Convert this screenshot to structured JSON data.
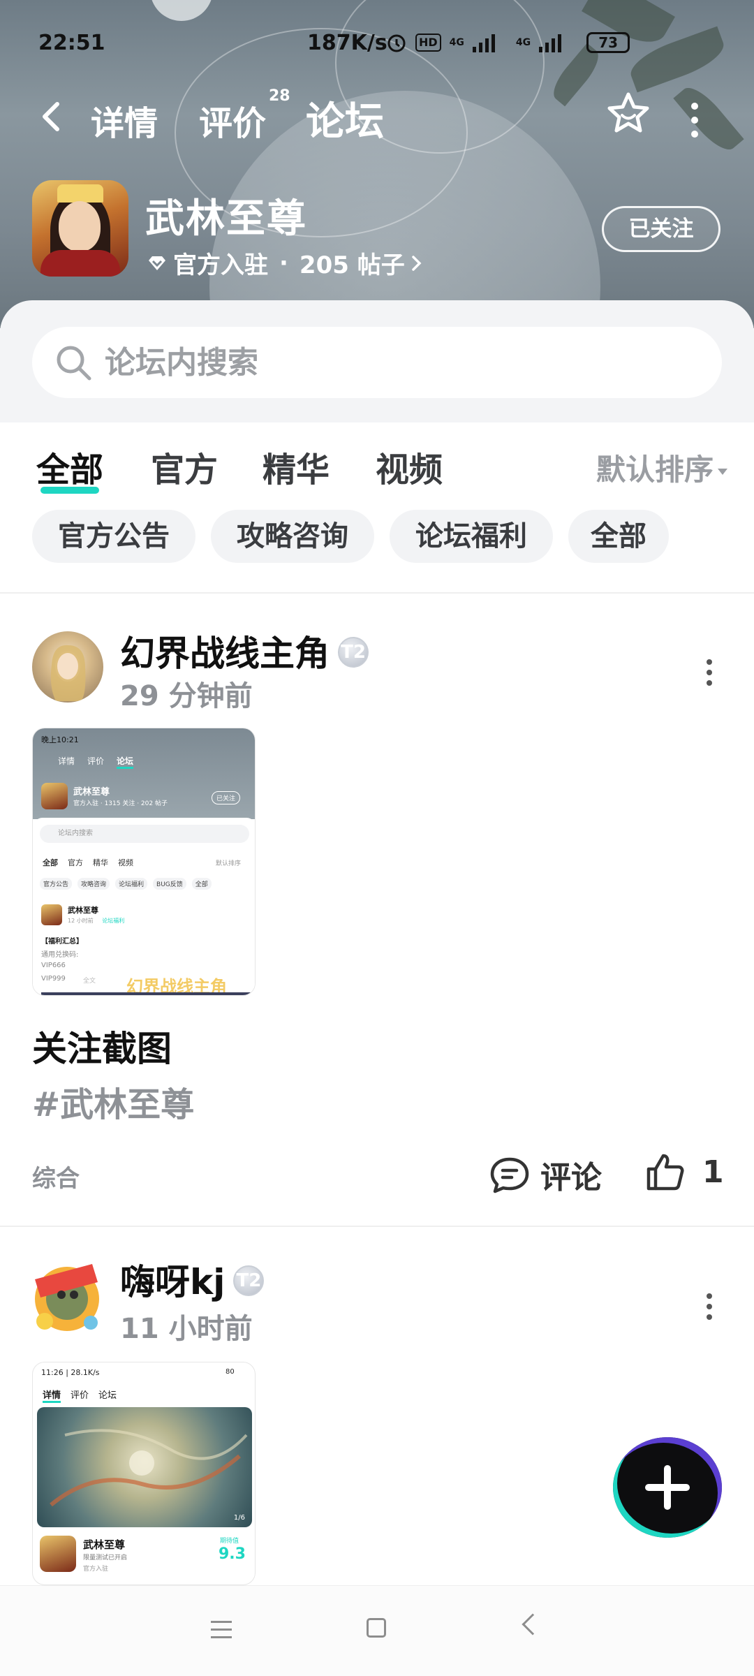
{
  "status_bar": {
    "time": "22:51",
    "net_speed": "187K/s",
    "hd": "HD",
    "net1": "4G",
    "net2": "4G",
    "battery": "73"
  },
  "nav": {
    "tabs": [
      {
        "label": "详情"
      },
      {
        "label": "评价",
        "badge": "28"
      },
      {
        "label": "论坛"
      }
    ],
    "active_tab": "论坛"
  },
  "app": {
    "name": "武林至尊",
    "official": "官方入驻",
    "separator": "·",
    "posts": "205 帖子",
    "follow_label": "已关注"
  },
  "search": {
    "placeholder": "论坛内搜索"
  },
  "filters": {
    "tabs": [
      "全部",
      "官方",
      "精华",
      "视频"
    ],
    "active": "全部",
    "sort_label": "默认排序",
    "chips": [
      "官方公告",
      "攻略咨询",
      "论坛福利",
      "全部"
    ]
  },
  "posts": [
    {
      "author": "幻界战线主角",
      "level": "T2",
      "time": "29 分钟前",
      "title": "关注截图",
      "tag": "#武林至尊",
      "category": "综合",
      "comment_label": "评论",
      "like_count": "1",
      "thumb": {
        "status_time": "晚上10:21",
        "tabs": [
          "详情",
          "评价",
          "论坛"
        ],
        "app_name": "武林至尊",
        "meta": "官方入驻 · 1315 关注 · 202 帖子",
        "follow": "已关注",
        "search": "论坛内搜索",
        "ftabs": [
          "全部",
          "官方",
          "精华",
          "视频"
        ],
        "sort": "默认排序",
        "chips": [
          "官方公告",
          "攻略咨询",
          "论坛福利",
          "BUG反馈",
          "全部"
        ],
        "post_author": "武林至尊",
        "post_meta": "12 小时前",
        "post_tag": "论坛福利",
        "lines": [
          "【福利汇总】",
          "通用兑换码:",
          "VIP666",
          "VIP999"
        ],
        "full": "全文",
        "overlay": "幻界战线主角"
      }
    },
    {
      "author": "嗨呀kj",
      "level": "T2",
      "time": "11 小时前",
      "thumb": {
        "status": "11:26 | 28.1K/s",
        "battery": "80",
        "tabs": [
          "详情",
          "评价",
          "论坛"
        ],
        "page": "1/6",
        "app_name": "武林至尊",
        "sub": "限量测试已开启",
        "official": "官方入驻",
        "score_label": "期待值",
        "score": "9.3"
      }
    }
  ],
  "colors": {
    "accent": "#1ed6c2",
    "muted": "#8e9196"
  }
}
